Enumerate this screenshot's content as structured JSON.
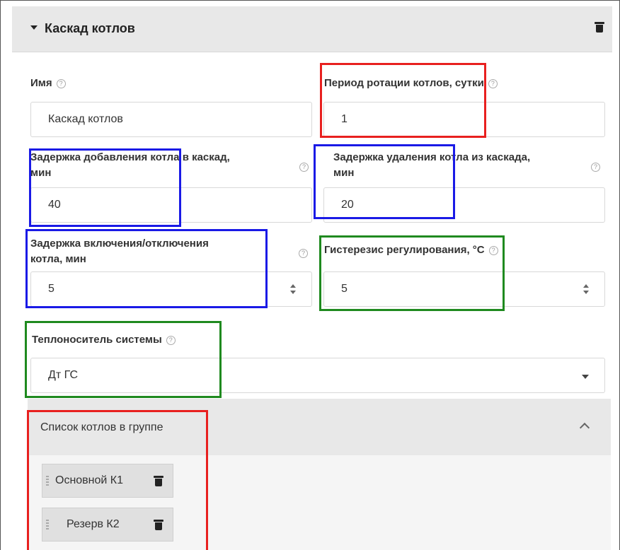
{
  "panel": {
    "title": "Каскад котлов"
  },
  "fields": {
    "name": {
      "label": "Имя",
      "value": "Каскад котлов"
    },
    "rotation_period": {
      "label": "Период ротации котлов, сутки",
      "value": "1"
    },
    "add_delay": {
      "label_line1": "Задержка добавления котла в каскад,",
      "label_line2": "мин",
      "value": "40"
    },
    "remove_delay": {
      "label_line1": "Задержка удаления котла из каскада,",
      "label_line2": "мин",
      "value": "20"
    },
    "switch_delay": {
      "label_line1": "Задержка включения/отключения",
      "label_line2": "котла, мин",
      "value": "5"
    },
    "hysteresis": {
      "label": "Гистерезис регулирования, °C",
      "value": "5"
    },
    "coolant": {
      "label": "Теплоноситель системы",
      "value": "Дт ГС"
    }
  },
  "help_glyph": "?",
  "boiler_list": {
    "title": "Список котлов в группе",
    "items": [
      {
        "name": "Основной К1"
      },
      {
        "name": "Резерв К2"
      }
    ]
  },
  "highlight_colors": {
    "red": "#e8201f",
    "blue": "#1a1ae6",
    "green": "#1f8a1f"
  }
}
